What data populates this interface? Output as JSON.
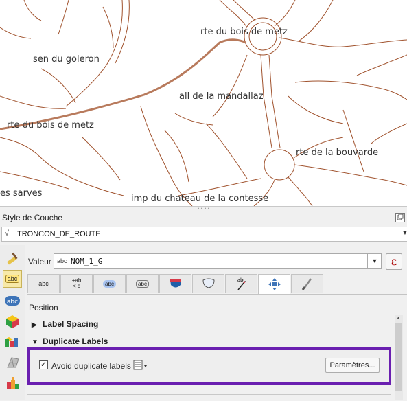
{
  "map": {
    "labels": [
      {
        "id": "bois-de-metz-top",
        "text": "rte du bois de metz"
      },
      {
        "id": "goleron",
        "text": "sen du goleron"
      },
      {
        "id": "mandallaz",
        "text": "all de la mandallaz"
      },
      {
        "id": "bois-de-metz-left",
        "text": "rte du bois de metz"
      },
      {
        "id": "bouvarde",
        "text": "rte de la bouvarde"
      },
      {
        "id": "sarves",
        "text": "es sarves"
      },
      {
        "id": "contesse",
        "text": "imp du chateau de la contesse"
      }
    ],
    "colors": {
      "road": "#a0522d",
      "main_road": "#b87a5c"
    }
  },
  "panel": {
    "title": "Style de Couche",
    "layer": "TRONCON_DE_ROUTE",
    "valeur_label": "Valeur",
    "expression_badge": "abc",
    "expression_value": "NOM_1_G",
    "epsilon_label": "ε",
    "tabs": [
      {
        "name": "text",
        "icon": "abc-text-icon"
      },
      {
        "name": "formatting",
        "icon": "abc-formatting-icon"
      },
      {
        "name": "buffer",
        "icon": "abc-buffer-icon"
      },
      {
        "name": "background",
        "icon": "abc-background-icon"
      },
      {
        "name": "shadow",
        "icon": "shield-icon"
      },
      {
        "name": "callouts",
        "icon": "callout-icon"
      },
      {
        "name": "placement",
        "icon": "abc-placement-icon"
      },
      {
        "name": "rendering",
        "icon": "move-icon"
      },
      {
        "name": "brush",
        "icon": "brush-icon"
      }
    ],
    "tab_text": {
      "text": "abc",
      "formatting_top": "+ab",
      "formatting_bottom": "< c",
      "buffer": "abc",
      "background": "abc",
      "placement": "abc"
    },
    "position_label": "Position",
    "sections": {
      "label_spacing": "Label Spacing",
      "duplicate_labels": "Duplicate Labels"
    },
    "avoid_duplicates_label": "Avoid duplicate labels",
    "avoid_duplicates_checked": true,
    "params_button": "Paramètres...",
    "strip_badge": "abc",
    "accent_color": "#6a1fb0"
  }
}
